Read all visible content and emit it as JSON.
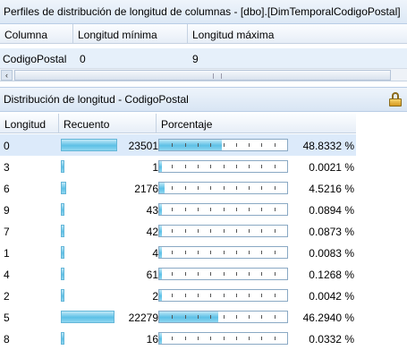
{
  "panel1": {
    "title": "Perfiles de distribución de longitud de columnas  -  [dbo].[DimTemporalCodigoPostal]",
    "headers": [
      "Columna",
      "Longitud mínima",
      "Longitud máxima"
    ],
    "row": {
      "columna": "CodigoPostal",
      "min": "0",
      "max": "9"
    },
    "scroll_left_arrow": "‹"
  },
  "panel2": {
    "title": "Distribución de longitud - CodigoPostal",
    "headers": [
      "Longitud",
      "Recuento",
      "Porcentaje"
    ],
    "rows": [
      {
        "longitud": "0",
        "recuento": "23501",
        "porcentaje": "48.8332 %",
        "pct_value": 48.8332,
        "count_value": 23501
      },
      {
        "longitud": "3",
        "recuento": "1",
        "porcentaje": "0.0021 %",
        "pct_value": 0.0021,
        "count_value": 1
      },
      {
        "longitud": "6",
        "recuento": "2176",
        "porcentaje": "4.5216 %",
        "pct_value": 4.5216,
        "count_value": 2176
      },
      {
        "longitud": "9",
        "recuento": "43",
        "porcentaje": "0.0894 %",
        "pct_value": 0.0894,
        "count_value": 43
      },
      {
        "longitud": "7",
        "recuento": "42",
        "porcentaje": "0.0873 %",
        "pct_value": 0.0873,
        "count_value": 42
      },
      {
        "longitud": "1",
        "recuento": "4",
        "porcentaje": "0.0083 %",
        "pct_value": 0.0083,
        "count_value": 4
      },
      {
        "longitud": "4",
        "recuento": "61",
        "porcentaje": "0.1268 %",
        "pct_value": 0.1268,
        "count_value": 61
      },
      {
        "longitud": "2",
        "recuento": "2",
        "porcentaje": "0.0042 %",
        "pct_value": 0.0042,
        "count_value": 2
      },
      {
        "longitud": "5",
        "recuento": "22279",
        "porcentaje": "46.2940 %",
        "pct_value": 46.294,
        "count_value": 22279
      },
      {
        "longitud": "8",
        "recuento": "16",
        "porcentaje": "0.0332 %",
        "pct_value": 0.0332,
        "count_value": 16
      }
    ],
    "selected_row": 0
  },
  "icons": {
    "lock": "lock-icon"
  },
  "colors": {
    "accent": "#5cc0e6",
    "selection": "#dceafa",
    "header": "#dce8f5"
  }
}
